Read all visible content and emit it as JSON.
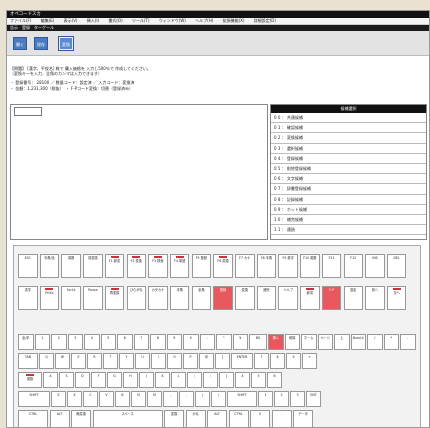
{
  "window": {
    "title": "オペコードスカ",
    "subtitle": "告示　登録　ターゲール"
  },
  "menu": [
    "ファイル(F)",
    "編集(E)",
    "表示(V)",
    "挿入(I)",
    "書式(O)",
    "ツール(T)",
    "ウィンドウ(W)",
    "ヘルプ(H)",
    "拡張機能(X)",
    "詳細設定(D)"
  ],
  "toolbar": {
    "buttons": [
      "開く",
      "保存",
      "変換"
    ]
  },
  "info": {
    "line1": "【問題】 [漢字、平仮名] 株で 購入価格を 入力し500％で 作成してください。",
    "line2": "（変換キーを入力、全角のカンマは入力できます）",
    "line3": "・ 登録番号： 28100 ／ 数量コード：設定済 ／ 入力コード：変換済",
    "line4": "・ 金額：1,231,300（税抜）　・ F-Pコード変換：切替（登録済み）"
  },
  "right_panel": {
    "header": "候補選択",
    "items": [
      "0 0 ： 共通候補",
      "0 1 ： 確認候補",
      "0 2 ： 変換候補",
      "0 3 ： 選択候補",
      "0 4 ： 登録候補",
      "0 5 ： 削除登録候補",
      "0 6 ： 文字候補",
      "0 7 ： 辞書登録候補",
      "0 8 ： 記録候補",
      "0 9 ： ホット候補",
      "1 0 ： 補完候補",
      "1 1 ： 通過"
    ]
  },
  "keyboard": {
    "row1": [
      "ESC",
      "半角/全",
      "英数",
      "前変換",
      "F1 辞書",
      "F2 変換",
      "F3 検索",
      "F4 単語",
      "F5 登録",
      "F6 変換",
      "F7 カナ",
      "F8 半角",
      "F9 英字",
      "F10 英数",
      "F11",
      "F12",
      "INS",
      "DEL"
    ],
    "row2": [
      "漢字",
      "PrtSc",
      "ScrLk",
      "Pause",
      "再変換",
      "ひらがな",
      "カタカナ",
      "半角",
      "全角",
      "登録",
      "変換",
      "補完",
      "ヘルプ",
      "辞書",
      "F-P",
      "設定",
      "前へ",
      "次へ"
    ],
    "row3": [
      "全/半",
      "1",
      "2",
      "3",
      "4",
      "5",
      "6",
      "7",
      "8",
      "9",
      "0",
      "-",
      "^",
      "¥",
      "BS",
      "挿入",
      "削除",
      "ホーム",
      "ページ",
      "上",
      "NumLk",
      "/",
      "*",
      "-"
    ],
    "row4": [
      "TAB",
      "Q",
      "W",
      "E",
      "R",
      "T",
      "Y",
      "U",
      "I",
      "O",
      "P",
      "@",
      "[",
      "ENTER",
      "7",
      "8",
      "9",
      "+"
    ],
    "row5": [
      "英数",
      "A",
      "S",
      "D",
      "F",
      "G",
      "H",
      "J",
      "K",
      "L",
      ";",
      ":",
      "]",
      "4",
      "5",
      "6"
    ],
    "row6": [
      "SHIFT",
      "Z",
      "X",
      "C",
      "V",
      "B",
      "N",
      "M",
      ",",
      ".",
      "/",
      "\\",
      "SHIFT",
      "1",
      "2",
      "3",
      "ENT"
    ],
    "row7": [
      "CTRL",
      "ALT",
      "無変換",
      "スペース",
      "変換",
      "かな",
      "ALT",
      "CTRL",
      "0",
      ".",
      "データ"
    ]
  }
}
